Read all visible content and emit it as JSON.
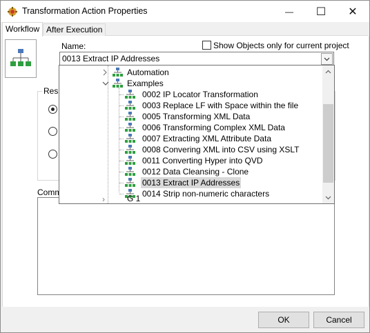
{
  "window": {
    "title": "Transformation Action Properties",
    "minimize_glyph": "—",
    "maximize_glyph": "☐",
    "close_glyph": "✕"
  },
  "tabs": [
    {
      "label": "Workflow",
      "active": true
    },
    {
      "label": "After Execution",
      "active": false
    }
  ],
  "name_field": {
    "label": "Name:",
    "value": "0013 Extract IP Addresses"
  },
  "show_objects_checkbox": {
    "label": "Show Objects only for current project",
    "checked": false
  },
  "result_group": {
    "title": "Resu",
    "options_selected_index": 0
  },
  "comments": {
    "label": "Comme"
  },
  "tree": {
    "folders": [
      {
        "label": "Automation",
        "expanded": false
      },
      {
        "label": "Examples",
        "expanded": true
      }
    ],
    "items": [
      {
        "label": "0002 IP Locator Transformation"
      },
      {
        "label": "0003 Replace LF with Space within the file"
      },
      {
        "label": "0005 Transforming XML Data"
      },
      {
        "label": "0006 Transforming Complex XML Data"
      },
      {
        "label": "0007 Extracting XML Attribute Data"
      },
      {
        "label": "0008 Convering XML into CSV using XSLT"
      },
      {
        "label": "0011 Converting Hyper into QVD"
      },
      {
        "label": "0012 Data Cleansing - Clone"
      },
      {
        "label": "0013 Extract IP Addresses"
      },
      {
        "label": "0014 Strip non-numeric characters"
      }
    ],
    "selected_index": 8,
    "partial_next": "G    1"
  },
  "buttons": {
    "ok": "OK",
    "cancel": "Cancel"
  },
  "colors": {
    "accent_icon_green": "#2e9e3f",
    "accent_icon_blue": "#4a78b8",
    "selection": "#d9d9d9"
  }
}
